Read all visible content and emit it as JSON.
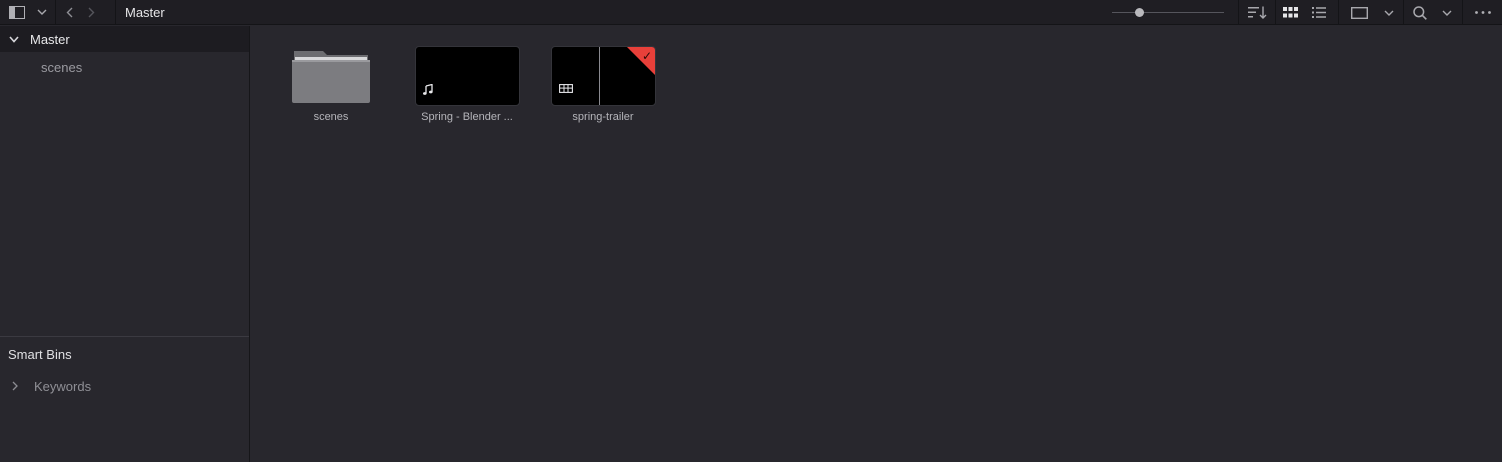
{
  "toolbar": {
    "breadcrumb": "Master",
    "icons": [
      "sidebar-toggle-icon",
      "chevron-down-icon",
      "back-icon",
      "forward-icon",
      "sort-icon",
      "grid-view-icon",
      "list-view-icon",
      "viewer-icon",
      "search-icon",
      "more-icon"
    ],
    "zoom_level": 0.22
  },
  "sidebar": {
    "root": {
      "label": "Master",
      "expanded": true
    },
    "children": [
      {
        "label": "scenes"
      }
    ],
    "smart_bins_title": "Smart Bins",
    "smart_bins": [
      {
        "label": "Keywords",
        "expanded": false
      }
    ]
  },
  "media": [
    {
      "name": "scenes",
      "kind": "folder"
    },
    {
      "name": "Spring - Blender ...",
      "kind": "audio"
    },
    {
      "name": "spring-trailer",
      "kind": "timeline",
      "flag_color": "#e8403a",
      "checked": true
    }
  ],
  "colors": {
    "background": "#28272d",
    "toolbar": "#1f1e23",
    "selected_row": "#1d1c21",
    "accent": "#e8403a"
  }
}
